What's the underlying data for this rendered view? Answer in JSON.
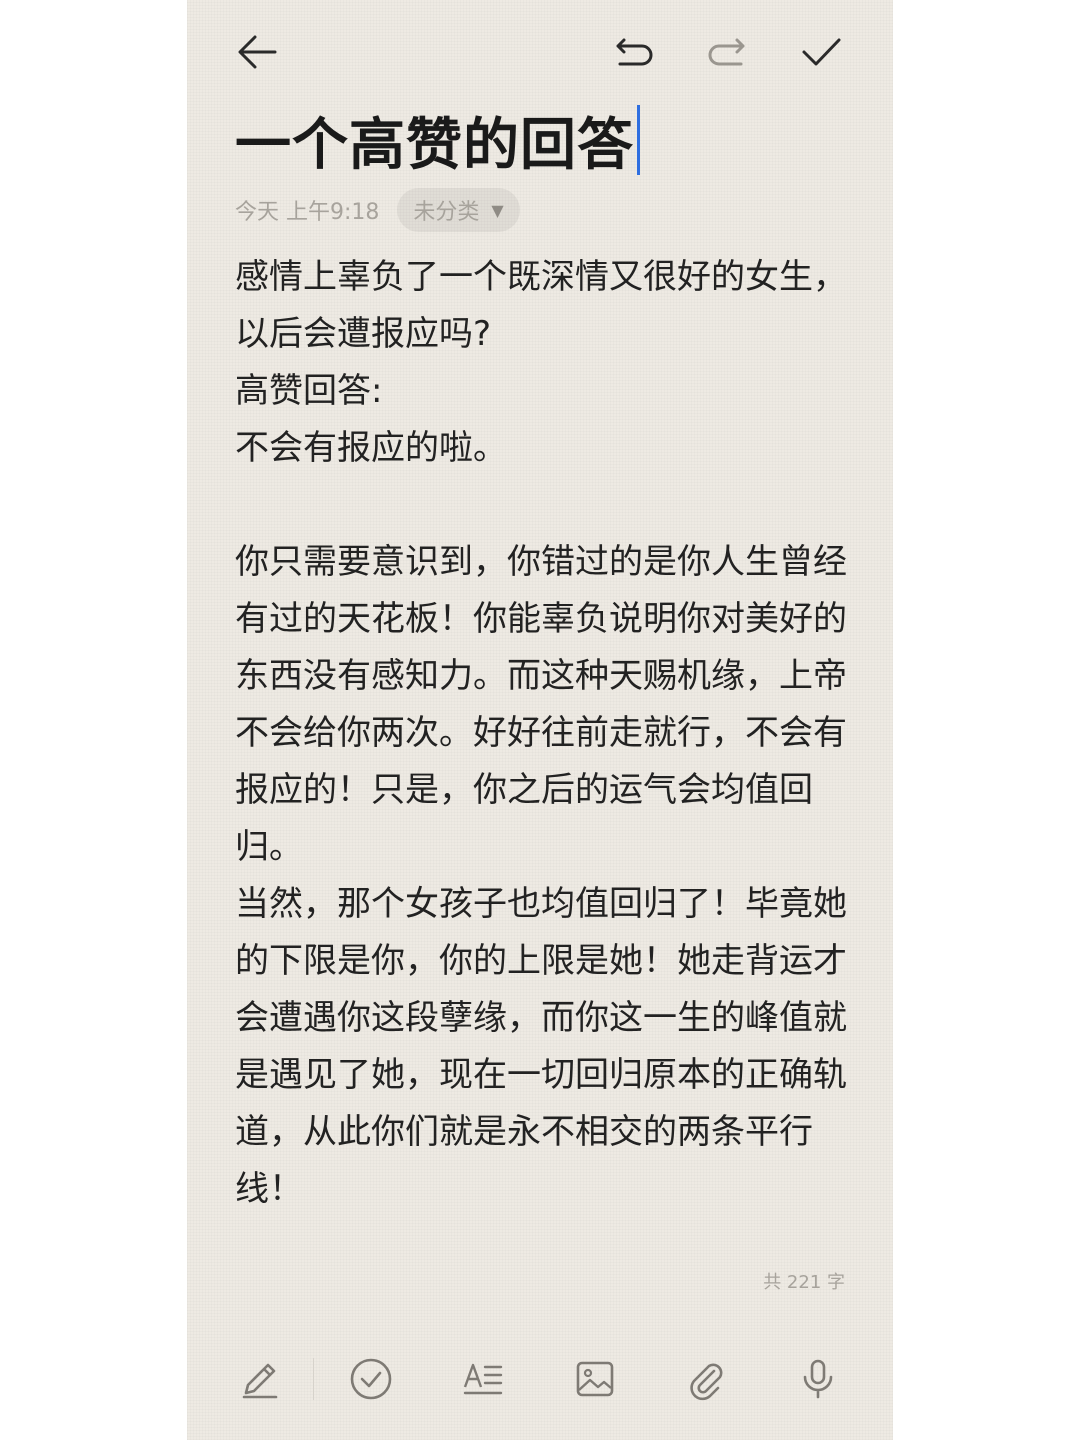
{
  "toolbar": {
    "back_icon": "arrow-left-icon",
    "undo_icon": "undo-icon",
    "redo_icon": "redo-icon",
    "done_icon": "check-icon"
  },
  "note": {
    "title": "一个高赞的回答",
    "date": "今天 上午9:18",
    "category": "未分类",
    "category_dropdown": "▼",
    "paragraphs": [
      "感情上辜负了一个既深情又很好的女生，以后会遭报应吗?",
      "高赞回答:",
      "不会有报应的啦。",
      "",
      "你只需要意识到，你错过的是你人生曾经有过的天花板！你能辜负说明你对美好的东西没有感知力。而这种天赐机缘，上帝不会给你两次。好好往前走就行，不会有报应的！只是，你之后的运气会均值回归。",
      "当然，那个女孩子也均值回归了！毕竟她的下限是你，你的上限是她！她走背运才会遭遇你这段孽缘，而你这一生的峰值就是遇见了她，现在一切回归原本的正确轨道，从此你们就是永不相交的两条平行线！"
    ],
    "word_count": "共 221 字"
  },
  "bottom_toolbar": {
    "icons": [
      "pen-icon",
      "checklist-icon",
      "text-format-icon",
      "image-icon",
      "attachment-icon",
      "microphone-icon"
    ]
  },
  "colors": {
    "background": "#eeeae3",
    "text": "#222222",
    "muted": "#a7a39c",
    "caret": "#2f6fe0"
  }
}
